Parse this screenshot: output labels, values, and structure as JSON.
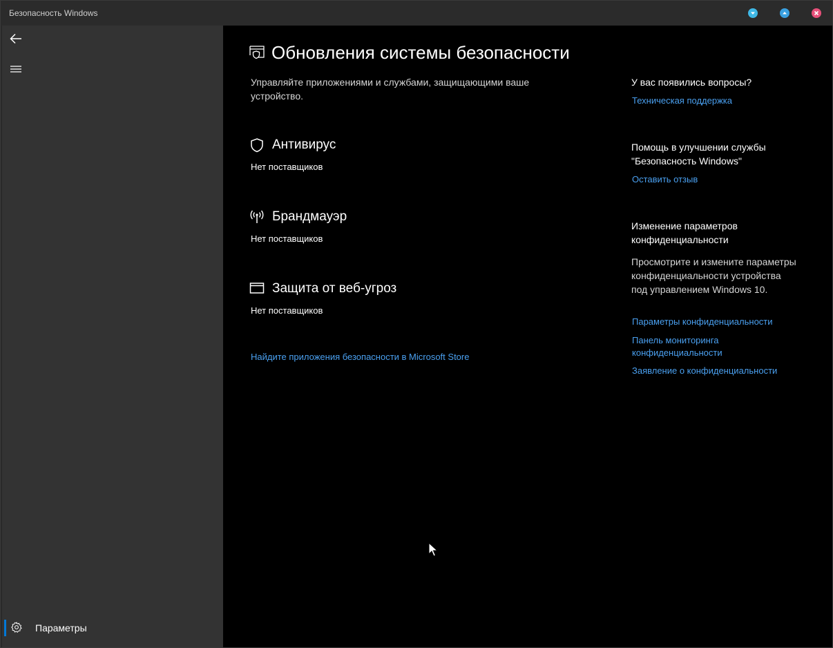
{
  "window": {
    "title": "Безопасность Windows"
  },
  "colors": {
    "accent": "#0078d7",
    "link": "#4aa0f0",
    "sidebar": "#333333",
    "main": "#000000",
    "min_btn": "#3fb8e6",
    "max_btn": "#3aa0e0",
    "close_btn": "#e8507a"
  },
  "titlebar_controls": [
    "minimize-icon",
    "maximize-icon",
    "close-icon"
  ],
  "sidebar": {
    "back_icon": "back-arrow-icon",
    "menu_icon": "hamburger-menu-icon",
    "settings_label": "Параметры",
    "settings_icon": "gear-icon"
  },
  "main": {
    "title": "Обновления системы безопасности",
    "description": "Управляйте приложениями и службами, защищающими ваше устройство.",
    "sections": [
      {
        "icon": "shield-icon",
        "title": "Антивирус",
        "status": "Нет поставщиков"
      },
      {
        "icon": "firewall-antenna-icon",
        "title": "Брандмауэр",
        "status": "Нет поставщиков"
      },
      {
        "icon": "browser-window-icon",
        "title": "Защита от веб-угроз",
        "status": "Нет поставщиков"
      }
    ],
    "store_link": "Найдите приложения безопасности в Microsoft Store"
  },
  "right": {
    "questions_heading": "У вас появились вопросы?",
    "support_link": "Техническая поддержка",
    "improve_heading": "Помощь в улучшении службы \"Безопасность Windows\"",
    "feedback_link": "Оставить отзыв",
    "privacy_heading": "Изменение параметров конфиденциальности",
    "privacy_text": "Просмотрите и измените параметры конфиденциальности устройства под управлением Windows 10.",
    "privacy_links": [
      "Параметры конфиденциальности",
      "Панель мониторинга конфиденциальности",
      "Заявление о конфиденциальности"
    ]
  }
}
